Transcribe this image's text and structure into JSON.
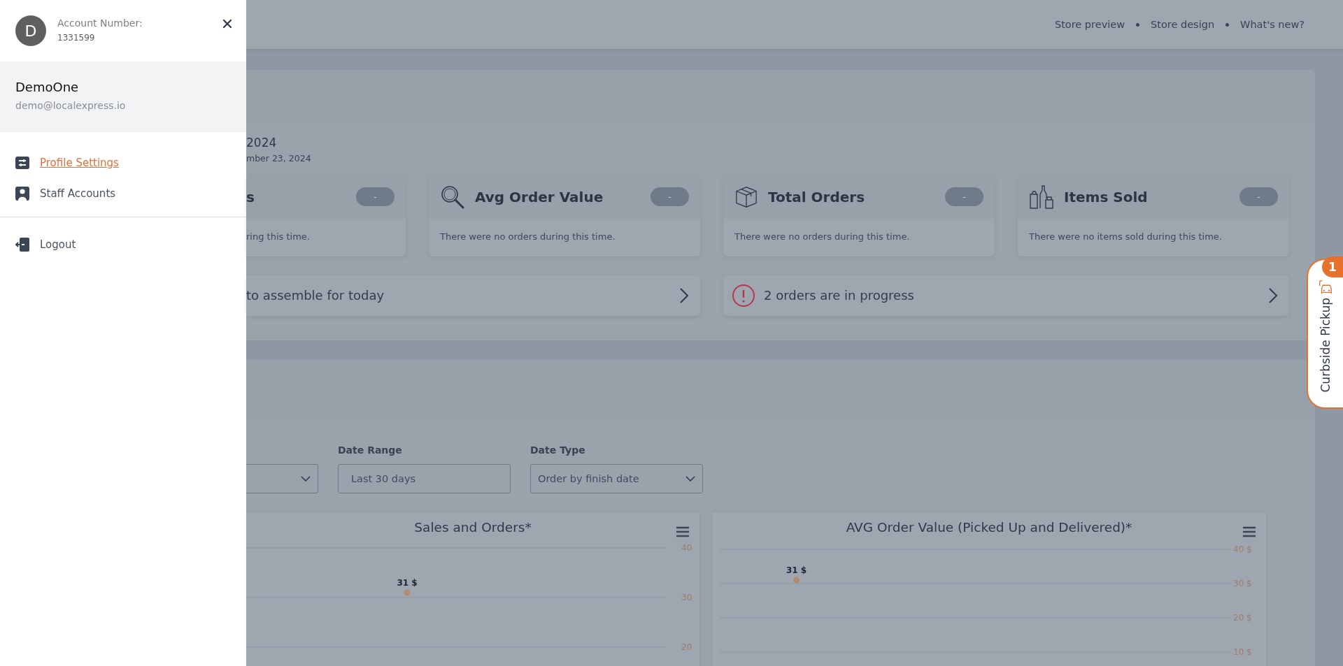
{
  "drawer": {
    "avatar_letter": "D",
    "account_label": "Account Number:",
    "account_number": "1331599",
    "user": {
      "name": "DemoOne",
      "email": "demo@localexpress.io"
    },
    "menu": [
      {
        "label": "Profile Settings",
        "selected": true
      },
      {
        "label": "Staff Accounts",
        "selected": false
      }
    ],
    "logout": "Logout"
  },
  "top_nav": [
    "Store preview",
    "Store design",
    "What's new?"
  ],
  "summary": {
    "date_title": "2024",
    "date_subtitle": "mber 23, 2024",
    "stats": [
      {
        "title": "s",
        "badge": "-",
        "note": "ring this time."
      },
      {
        "title": "Avg Order Value",
        "badge": "-",
        "note": "There were no orders during this time."
      },
      {
        "title": "Total Orders",
        "badge": "-",
        "note": "There were no orders during this time."
      },
      {
        "title": "Items Sold",
        "badge": "-",
        "note": "There were no items sold during this time."
      }
    ],
    "alerts": [
      {
        "kind": "plain",
        "text": "to assemble for today"
      },
      {
        "kind": "warning",
        "text": "2 orders are in progress"
      }
    ]
  },
  "filters": [
    {
      "kind": "select"
    },
    {
      "kind": "input",
      "label": "Date Range",
      "value": "Last 30 days"
    },
    {
      "kind": "select",
      "label": "Date Type",
      "value": "Order by finish date"
    }
  ],
  "charts": [
    {
      "chart_data": {
        "type": "line",
        "title": "Sales and Orders*",
        "grid": true,
        "ylim": [
          20,
          40
        ],
        "yticks": [
          20,
          30,
          40
        ],
        "series": [
          {
            "color": "#b48a6c",
            "marker": true,
            "values": [
              null,
              null,
              null,
              null,
              null,
              null,
              null,
              null,
              null,
              null,
              null,
              31,
              null,
              null,
              null,
              null,
              null,
              null,
              null,
              null,
              null,
              null,
              null,
              null,
              null,
              null,
              null,
              null,
              null,
              null
            ]
          }
        ],
        "annotations": [
          {
            "y": 31,
            "text": "31 $"
          }
        ]
      }
    },
    {
      "chart_data": {
        "type": "line",
        "title": "AVG Order Value (Picked Up and Delivered)*",
        "grid": true,
        "ylim": [
          10,
          40
        ],
        "yticks": [
          {
            "value": 10,
            "label": "10 $"
          },
          {
            "value": 20,
            "label": "20 $"
          },
          {
            "value": 30,
            "label": "30 $"
          },
          {
            "value": 40,
            "label": "40 $"
          }
        ],
        "series": [
          {
            "color": "#b48a6c",
            "marker": true,
            "values": [
              null,
              null,
              null,
              null,
              31,
              null,
              null,
              null,
              null,
              null,
              null,
              null,
              null,
              null,
              null,
              null,
              null,
              null,
              null,
              null,
              null,
              null,
              null,
              null,
              null,
              null,
              null,
              null,
              null,
              null
            ]
          }
        ],
        "annotations": [
          {
            "y": 31,
            "text": "31 $"
          }
        ]
      }
    }
  ],
  "curbside_tab": {
    "label": "Curbside Pickup",
    "badge": "1"
  }
}
